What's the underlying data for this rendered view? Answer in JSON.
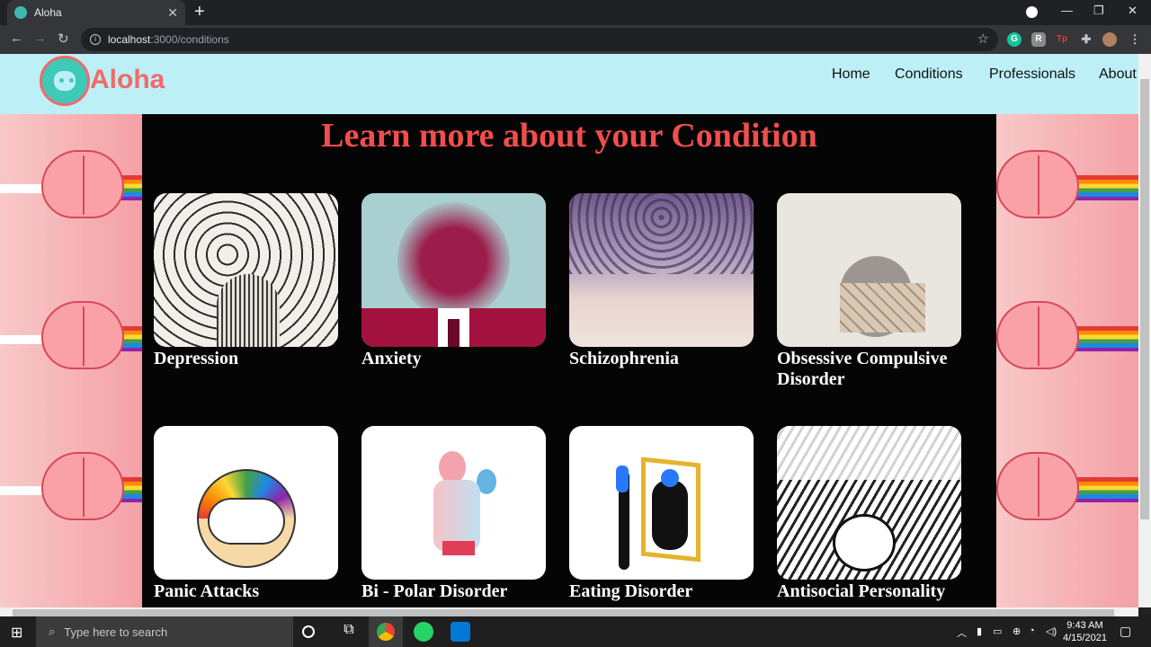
{
  "browser": {
    "tab_title": "Aloha",
    "tab_close": "✕",
    "new_tab": "+",
    "url_host": "localhost",
    "url_path": ":3000/conditions",
    "window_minimize": "—",
    "window_maximize": "❐",
    "window_close": "✕",
    "extensions": [
      "G",
      "R",
      "Tp"
    ]
  },
  "site": {
    "logo_text": "Aloha",
    "nav": [
      "Home",
      "Conditions",
      "Professionals",
      "About"
    ]
  },
  "main": {
    "heading": "Learn more about your Condition",
    "conditions": [
      {
        "label": "Depression",
        "image": "blah-speech-bubbles-head"
      },
      {
        "label": "Anxiety",
        "image": "scribbled-face-in-suit"
      },
      {
        "label": "Schizophrenia",
        "image": "swirling-faces-drawing"
      },
      {
        "label": "Obsessive Compulsive Disorder",
        "image": "figure-with-cubes-head"
      },
      {
        "label": "Panic Attacks",
        "image": "i-survived-a-panic-attack-cloud"
      },
      {
        "label": "Bi - Polar Disorder",
        "image": "two-tone-figure"
      },
      {
        "label": "Eating Disorder",
        "image": "girl-looking-in-mirror"
      },
      {
        "label": "Antisocial Personality",
        "image": "antisocial-sketch"
      }
    ]
  },
  "taskbar": {
    "search_placeholder": "Type here to search",
    "time": "9:43 AM",
    "date": "4/15/2021"
  }
}
